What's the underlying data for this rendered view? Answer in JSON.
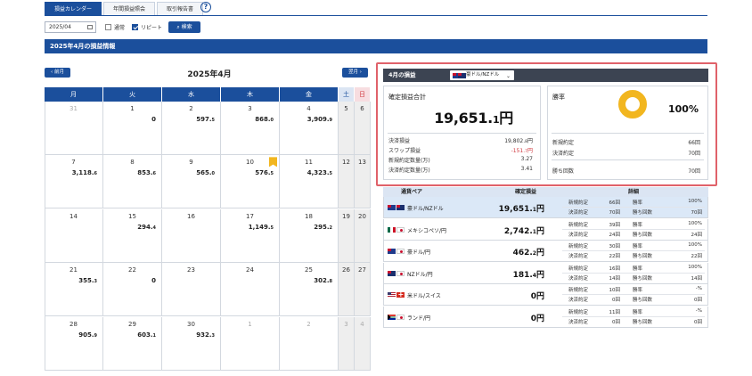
{
  "tabs": [
    {
      "label": "損益カレンダー",
      "active": true
    },
    {
      "label": "年間損益照会",
      "active": false
    },
    {
      "label": "取引報告書",
      "active": false
    }
  ],
  "help_icon": "question-circle-icon",
  "search": {
    "month": "2025/04",
    "checkbox_regular": {
      "label": "通常",
      "checked": false
    },
    "checkbox_repeat": {
      "label": "リピート",
      "checked": true
    },
    "search_button": "検索"
  },
  "section_title": "2025年4月の損益情報",
  "calendar": {
    "prev_label": "前月",
    "next_label": "翌月",
    "title": "2025年4月",
    "weekdays": [
      "月",
      "火",
      "水",
      "木",
      "金",
      "土",
      "日"
    ],
    "weeks": [
      [
        {
          "d": "31",
          "muted": true,
          "v": "",
          "s": ""
        },
        {
          "d": "1",
          "v": "0",
          "s": ""
        },
        {
          "d": "2",
          "v": "597.",
          "s": "5"
        },
        {
          "d": "3",
          "v": "868.",
          "s": "0"
        },
        {
          "d": "4",
          "v": "3,909.",
          "s": "9"
        },
        {
          "d": "5",
          "v": "",
          "s": ""
        },
        {
          "d": "6",
          "v": "",
          "s": ""
        }
      ],
      [
        {
          "d": "7",
          "v": "3,118.",
          "s": "6"
        },
        {
          "d": "8",
          "v": "853.",
          "s": "6"
        },
        {
          "d": "9",
          "v": "565.",
          "s": "0"
        },
        {
          "d": "10",
          "v": "576.",
          "s": "5",
          "bookmark": true
        },
        {
          "d": "11",
          "v": "4,323.",
          "s": "5"
        },
        {
          "d": "12",
          "v": "",
          "s": ""
        },
        {
          "d": "13",
          "v": "",
          "s": ""
        }
      ],
      [
        {
          "d": "14",
          "v": "",
          "s": ""
        },
        {
          "d": "15",
          "v": "294.",
          "s": "4"
        },
        {
          "d": "16",
          "v": "",
          "s": ""
        },
        {
          "d": "17",
          "v": "1,149.",
          "s": "5"
        },
        {
          "d": "18",
          "v": "295.",
          "s": "2"
        },
        {
          "d": "19",
          "v": "",
          "s": ""
        },
        {
          "d": "20",
          "v": "",
          "s": ""
        }
      ],
      [
        {
          "d": "21",
          "v": "355.",
          "s": "3"
        },
        {
          "d": "22",
          "v": "0",
          "s": ""
        },
        {
          "d": "23",
          "v": "",
          "s": ""
        },
        {
          "d": "24",
          "v": "",
          "s": ""
        },
        {
          "d": "25",
          "v": "302.",
          "s": "8"
        },
        {
          "d": "26",
          "v": "",
          "s": ""
        },
        {
          "d": "27",
          "v": "",
          "s": ""
        }
      ],
      [
        {
          "d": "28",
          "v": "905.",
          "s": "9"
        },
        {
          "d": "29",
          "v": "603.",
          "s": "1"
        },
        {
          "d": "30",
          "v": "932.",
          "s": "3"
        },
        {
          "d": "1",
          "muted": true,
          "v": "",
          "s": ""
        },
        {
          "d": "2",
          "muted": true,
          "v": "",
          "s": ""
        },
        {
          "d": "3",
          "muted": true,
          "v": "",
          "s": ""
        },
        {
          "d": "4",
          "muted": true,
          "v": "",
          "s": ""
        }
      ]
    ]
  },
  "summary": {
    "title": "4月の損益",
    "selected_pair": "豪ドル/NZドル",
    "total_label": "確定損益合計",
    "total_main": "19,651.",
    "total_small": "1",
    "total_unit": "円",
    "rows": [
      {
        "label": "決済損益",
        "main": "19,802.",
        "small": "8",
        "unit": "円",
        "neg": false
      },
      {
        "label": "スワップ損益",
        "main": "-151.",
        "small": "7",
        "unit": "円",
        "neg": true
      },
      {
        "label": "新規約定数量(万)",
        "main": "3.27",
        "small": "",
        "unit": "",
        "neg": false
      },
      {
        "label": "決済約定数量(万)",
        "main": "3.41",
        "small": "",
        "unit": "",
        "neg": false
      }
    ],
    "rate_label": "勝率",
    "rate_value": "100%",
    "rate_fraction": 1.0,
    "rate_color": "#f2b61f",
    "rate_rows": [
      {
        "label": "新規約定",
        "value": "66回"
      },
      {
        "label": "決済約定",
        "value": "70回"
      },
      {
        "label": "勝ち回数",
        "value": "70回"
      }
    ]
  },
  "pairs_table": {
    "col_pair": "通貨ペア",
    "col_pl": "確定損益",
    "col_detail": "詳細",
    "label_new": "新規約定",
    "label_close": "決済約定",
    "label_rate": "勝率",
    "label_wins": "勝ち回数",
    "rows": [
      {
        "flags": [
          "au",
          "nz"
        ],
        "name": "豪ドル/NZドル",
        "main": "19,651.",
        "small": "1",
        "unit": "円",
        "new": "66回",
        "close": "70回",
        "rate": "100%",
        "wins": "70回",
        "selected": true
      },
      {
        "flags": [
          "mx",
          "jp"
        ],
        "name": "メキシコペソ/円",
        "main": "2,742.",
        "small": "1",
        "unit": "円",
        "new": "39回",
        "close": "24回",
        "rate": "100%",
        "wins": "24回",
        "selected": false
      },
      {
        "flags": [
          "au",
          "jp"
        ],
        "name": "豪ドル/円",
        "main": "462.",
        "small": "2",
        "unit": "円",
        "new": "30回",
        "close": "22回",
        "rate": "100%",
        "wins": "22回",
        "selected": false
      },
      {
        "flags": [
          "nz",
          "jp"
        ],
        "name": "NZドル/円",
        "main": "181.",
        "small": "4",
        "unit": "円",
        "new": "16回",
        "close": "14回",
        "rate": "100%",
        "wins": "14回",
        "selected": false
      },
      {
        "flags": [
          "us",
          "ch"
        ],
        "name": "米ドル/スイス",
        "main": "0",
        "small": "",
        "unit": "円",
        "new": "10回",
        "close": "0回",
        "rate": "-%",
        "wins": "0回",
        "selected": false
      },
      {
        "flags": [
          "za",
          "jp"
        ],
        "name": "ランド/円",
        "main": "0",
        "small": "",
        "unit": "円",
        "new": "11回",
        "close": "0回",
        "rate": "-%",
        "wins": "0回",
        "selected": false
      }
    ]
  }
}
